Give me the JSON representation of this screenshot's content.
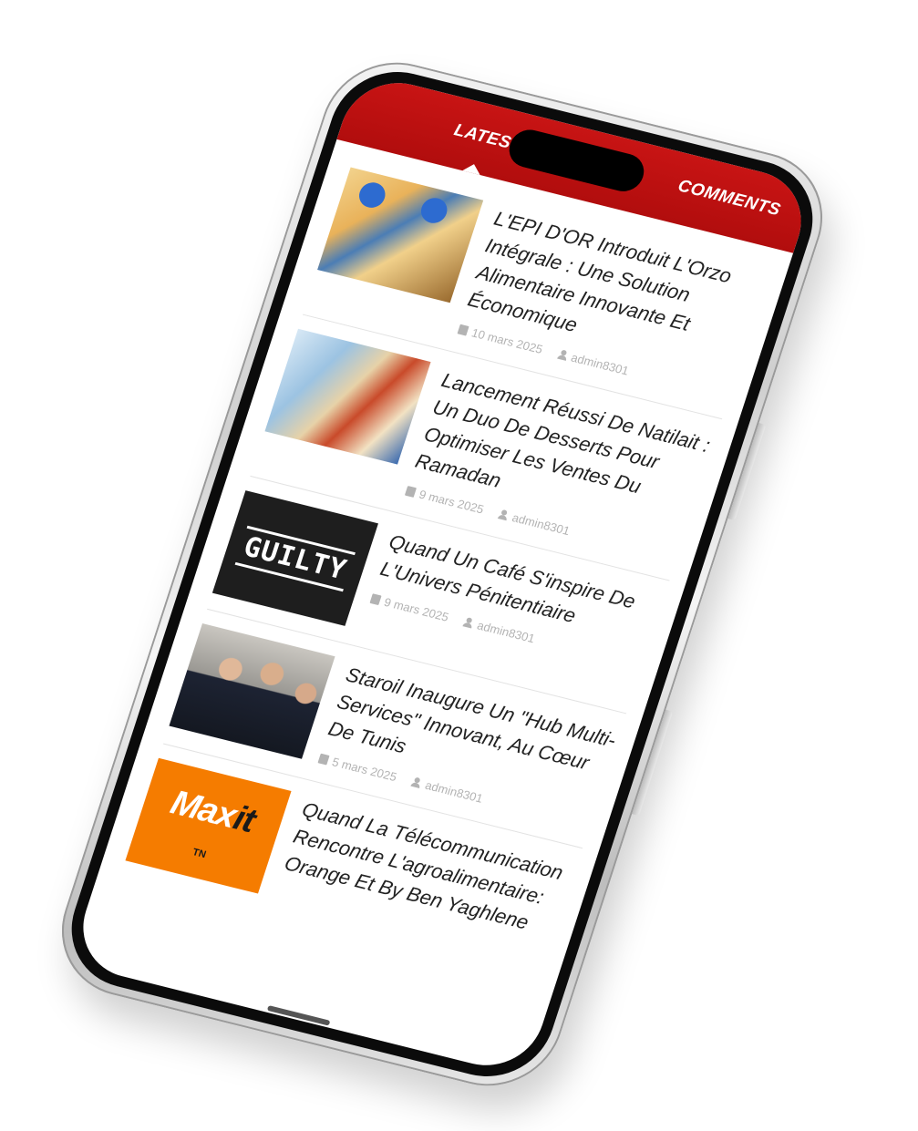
{
  "tabs": [
    {
      "label": "LATEST",
      "active": true
    },
    {
      "label": "COMMENTS",
      "active": false
    }
  ],
  "articles": [
    {
      "title": "L'EPI D'OR Introduit L'Orzo Intégrale : Une Solution Alimentaire Innovante Et Économique",
      "date": "10 mars 2025",
      "author": "admin8301",
      "thumb": "food"
    },
    {
      "title": "Lancement Réussi De Natilait : Un Duo De Desserts Pour Optimiser Les Ventes Du Ramadan",
      "date": "9 mars 2025",
      "author": "admin8301",
      "thumb": "dessert"
    },
    {
      "title": "Quand Un Café S'inspire De L'Univers Pénitentiaire",
      "date": "9 mars 2025",
      "author": "admin8301",
      "thumb": "guilty",
      "thumb_text": "GUILTY"
    },
    {
      "title": "Staroil Inaugure Un \"Hub Multi-Services\" Innovant, Au Cœur De Tunis",
      "date": "5 mars 2025",
      "author": "admin8301",
      "thumb": "people"
    },
    {
      "title": "Quand La Télécommunication Rencontre L'agroalimentaire: Orange Et By Ben Yaghlene",
      "date": "",
      "author": "",
      "thumb": "maxit",
      "thumb_logo": "Max",
      "thumb_logo_it": "it",
      "thumb_sub": "TN"
    }
  ],
  "colors": {
    "tab_bar": "#c81414",
    "maxit": "#f57c00"
  }
}
